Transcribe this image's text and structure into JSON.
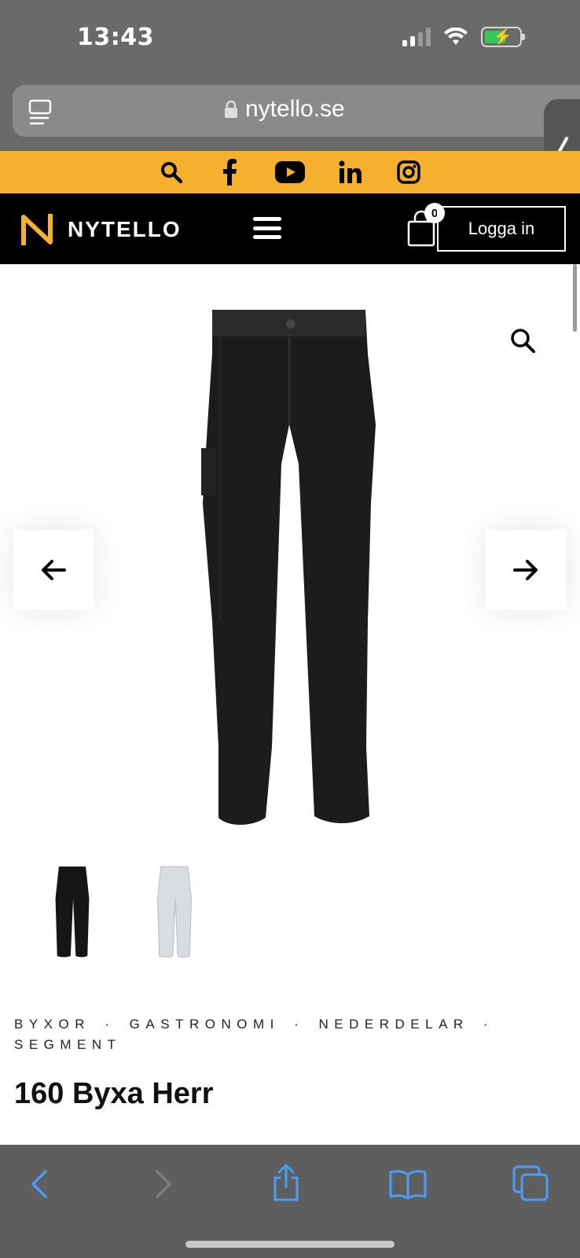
{
  "status_bar": {
    "time": "13:43",
    "icons": [
      "cellular-signal-icon",
      "wifi-icon",
      "battery-charging-icon"
    ]
  },
  "browser": {
    "url": "nytello.se",
    "icons": [
      "tabs-icon",
      "lock-icon",
      "reload-icon"
    ]
  },
  "social": {
    "icons": [
      "search-icon",
      "facebook-icon",
      "youtube-icon",
      "linkedin-icon",
      "instagram-icon"
    ],
    "bar_color": "#f5b02d"
  },
  "nav": {
    "logo_text": "NYTELLO",
    "cart_count": "0",
    "login_label": "Logga in",
    "accent_color": "#f5b02d"
  },
  "gallery": {
    "icons": [
      "zoom-icon",
      "arrow-left-icon",
      "arrow-right-icon"
    ],
    "thumbnails": [
      {
        "color": "black"
      },
      {
        "color": "white"
      }
    ]
  },
  "product": {
    "categories": [
      "BYXOR",
      "GASTRONOMI",
      "NEDERDELAR",
      "SEGMENT"
    ],
    "separator": "·",
    "title": "160 Byxa Herr"
  },
  "toolbar": {
    "icons": [
      "back-icon",
      "forward-icon",
      "share-icon",
      "bookmarks-icon",
      "tabs-overview-icon"
    ]
  }
}
